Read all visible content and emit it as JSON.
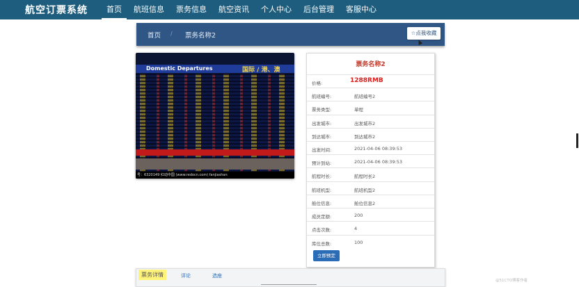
{
  "nav": {
    "brand": "航空订票系统",
    "items": [
      {
        "label": "首页",
        "active": true
      },
      {
        "label": "航班信息"
      },
      {
        "label": "票务信息"
      },
      {
        "label": "航空资讯"
      },
      {
        "label": "个人中心"
      },
      {
        "label": "后台管理"
      },
      {
        "label": "客服中心"
      }
    ]
  },
  "breadcrumb": {
    "home": "首页",
    "separator": "/",
    "current": "票务名称2",
    "favorite_button": "☆点我收藏"
  },
  "photo": {
    "board_title_left": "Domestic Departures",
    "board_title_right": "国际 / 港、澳",
    "caption": "号：6320149   红动中国 (www.redocn.com)   fanjiashan"
  },
  "ticket": {
    "title": "票务名称2",
    "price_label": "价格:",
    "price_value": "1288RMB",
    "fields": [
      {
        "label": "航班编号:",
        "value": "航班编号2"
      },
      {
        "label": "票务类型:",
        "value": "单程"
      },
      {
        "label": "出发城市:",
        "value": "出发城市2"
      },
      {
        "label": "到达城市:",
        "value": "到达城市2"
      },
      {
        "label": "出发时间:",
        "value": "2021-04-06 08:39:53"
      },
      {
        "label": "预计到站:",
        "value": "2021-04-06 08:39:53"
      },
      {
        "label": "航程时长:",
        "value": "航程时长2"
      },
      {
        "label": "航班机型:",
        "value": "航班机型2"
      },
      {
        "label": "舱位信息:",
        "value": "舱位信息2"
      },
      {
        "label": "成员定额:",
        "value": "200"
      },
      {
        "label": "点击次数:",
        "value": "4"
      },
      {
        "label": "库位总数:",
        "value": "100"
      }
    ],
    "book_button": "立即预定"
  },
  "tabs": [
    {
      "label": "票务详情",
      "active": true
    },
    {
      "label": "评论"
    },
    {
      "label": "选座"
    }
  ],
  "watermark": "@51CTO博客作者"
}
